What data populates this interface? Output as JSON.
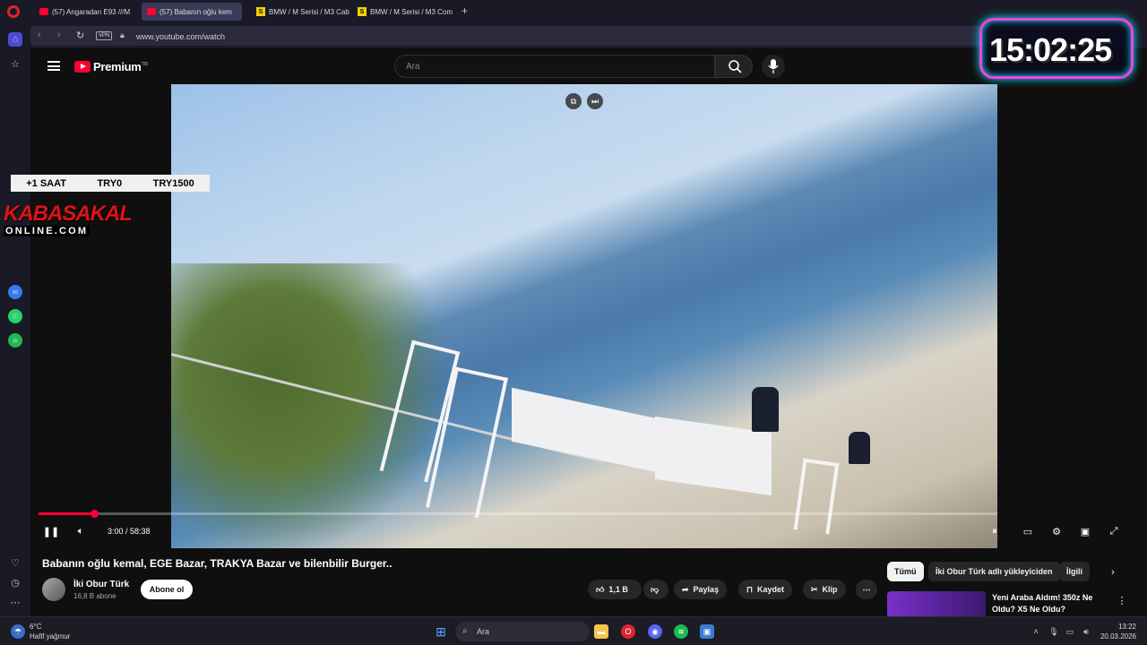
{
  "browser": {
    "tabs": [
      {
        "label": "(57) Angaradan E93 ///M",
        "kind": "youtube"
      },
      {
        "label": "(57) Babanın oğlu kem",
        "kind": "youtube",
        "active": true
      },
      {
        "label": "BMW / M Serisi / M3 Cab",
        "kind": "sahibinden"
      },
      {
        "label": "BMW / M Serisi / M3 Com",
        "kind": "sahibinden"
      }
    ],
    "vpn_label": "VPN",
    "url": "www.youtube.com/watch"
  },
  "youtube": {
    "logo_text": "Premium",
    "region": "TR",
    "search_placeholder": "Ara"
  },
  "overlay": {
    "clock": "15:02:25",
    "stream_labels": [
      "+1 SAAT",
      "TRY0",
      "TRY1500"
    ],
    "brand_main": "KABASAKAL",
    "brand_sub": "ONLINE.COM"
  },
  "player": {
    "time_display": "3:00 / 58:38",
    "progress_fraction": 0.058
  },
  "video": {
    "title": "Babanın oğlu kemal, EGE Bazar, TRAKYA Bazar ve bilenbilir Burger..",
    "channel": "İki Obur Türk",
    "subscribers": "16,8 B abone",
    "subscribe_label": "Abone ol",
    "likes": "1,1 B",
    "share_label": "Paylaş",
    "save_label": "Kaydet",
    "clip_label": "Klip"
  },
  "related": {
    "chips": [
      "Tümü",
      "İki Obur Türk adlı yükleyiciden",
      "İlgili"
    ],
    "first_title": "Yeni Araba Aldım! 350z Ne Oldu? X5 Ne Oldu?"
  },
  "taskbar": {
    "weather_temp": "6°C",
    "weather_desc": "Hafif yağmur",
    "search_label": "Ara",
    "time": "13:22",
    "date": "20.03.2026"
  },
  "colors": {
    "accent_red": "#ff0033",
    "clock_glow": "#ff3ee6"
  }
}
